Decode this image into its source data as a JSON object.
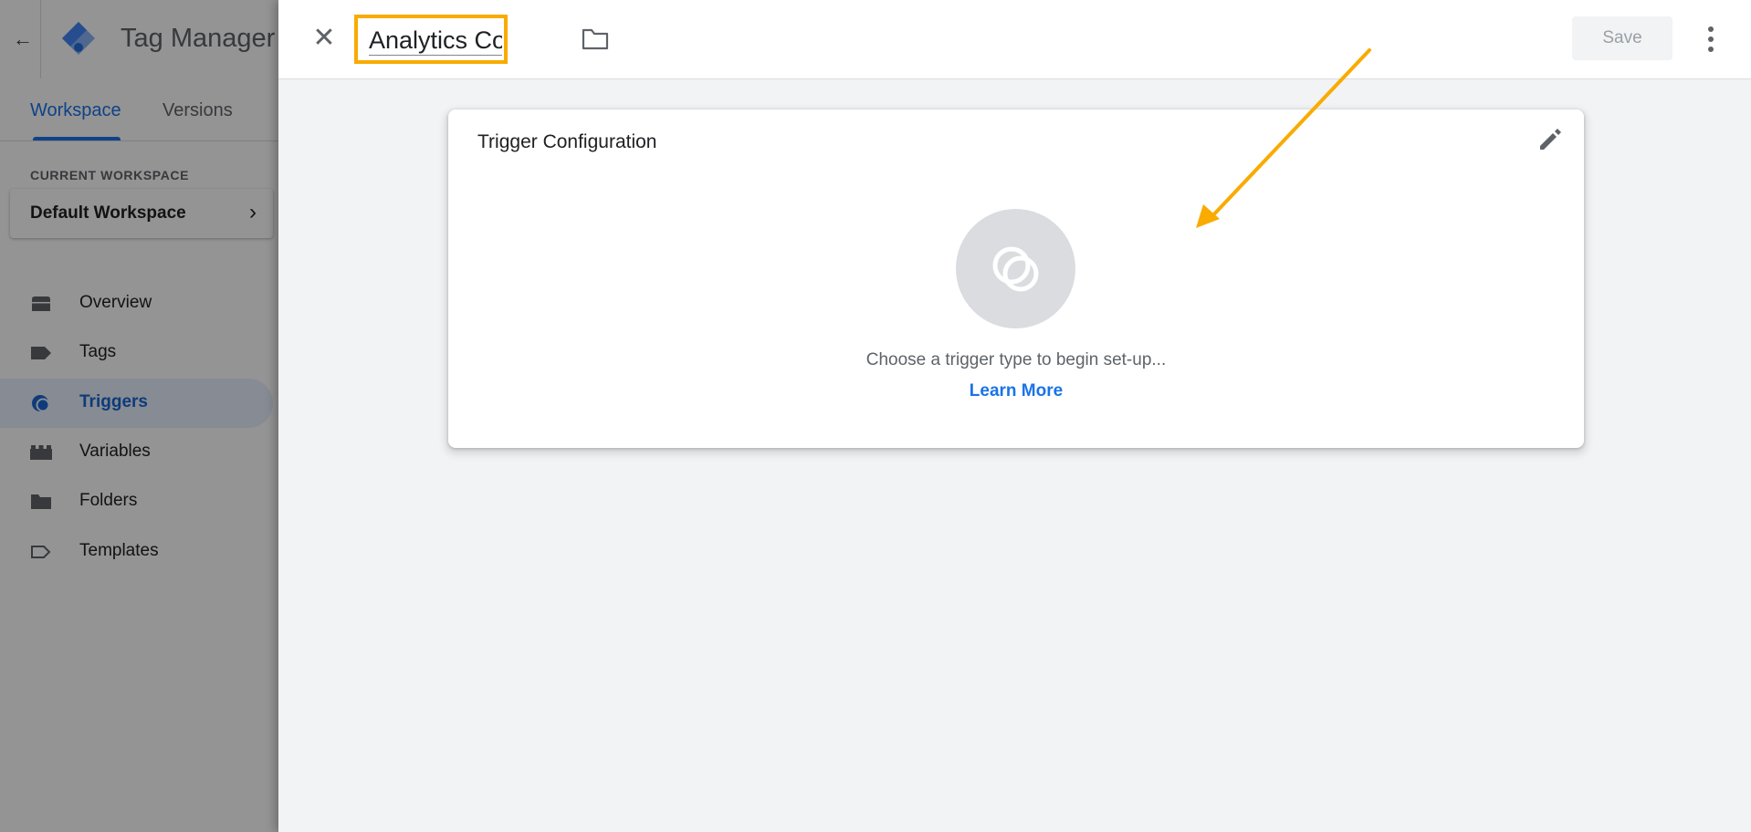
{
  "header": {
    "back_icon": "arrow-back-icon",
    "app_title": "Tag Manager",
    "logo": "gtm-logo"
  },
  "tabs": [
    {
      "label": "Workspace",
      "active": true
    },
    {
      "label": "Versions",
      "active": false
    }
  ],
  "workspace": {
    "label": "CURRENT WORKSPACE",
    "name": "Default Workspace"
  },
  "nav": [
    {
      "label": "Overview",
      "icon": "overview-icon",
      "active": false
    },
    {
      "label": "Tags",
      "icon": "tag-icon",
      "active": false
    },
    {
      "label": "Triggers",
      "icon": "trigger-icon",
      "active": true
    },
    {
      "label": "Variables",
      "icon": "variables-icon",
      "active": false
    },
    {
      "label": "Folders",
      "icon": "folder-icon",
      "active": false
    },
    {
      "label": "Templates",
      "icon": "templates-icon",
      "active": false
    }
  ],
  "editor": {
    "name_value": "Analytics Cookies",
    "save_label": "Save",
    "card": {
      "title": "Trigger Configuration",
      "hint": "Choose a trigger type to begin set-up...",
      "learn_more": "Learn More"
    }
  },
  "colors": {
    "accent": "#1a73e8",
    "highlight": "#f9ab00",
    "active_nav_bg": "#e8f0fe"
  }
}
